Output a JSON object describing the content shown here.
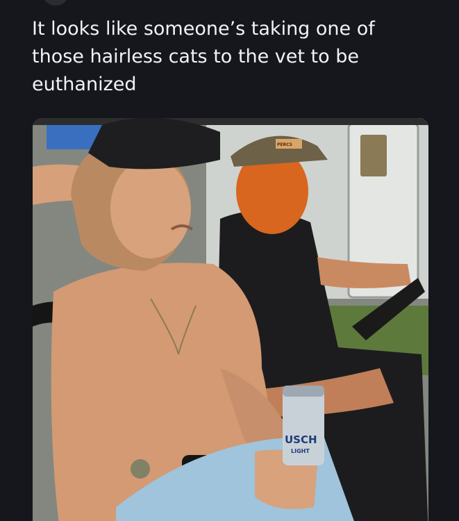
{
  "post": {
    "text": "It looks like someone’s taking one of\nthose hairless cats to the vet to be\neuthanized"
  },
  "photo": {
    "can_label": "USCH",
    "can_sublabel": "LIGHT",
    "hat_badge": "PERCS"
  },
  "colors": {
    "background": "#15171d",
    "text": "#f2f3f5"
  }
}
